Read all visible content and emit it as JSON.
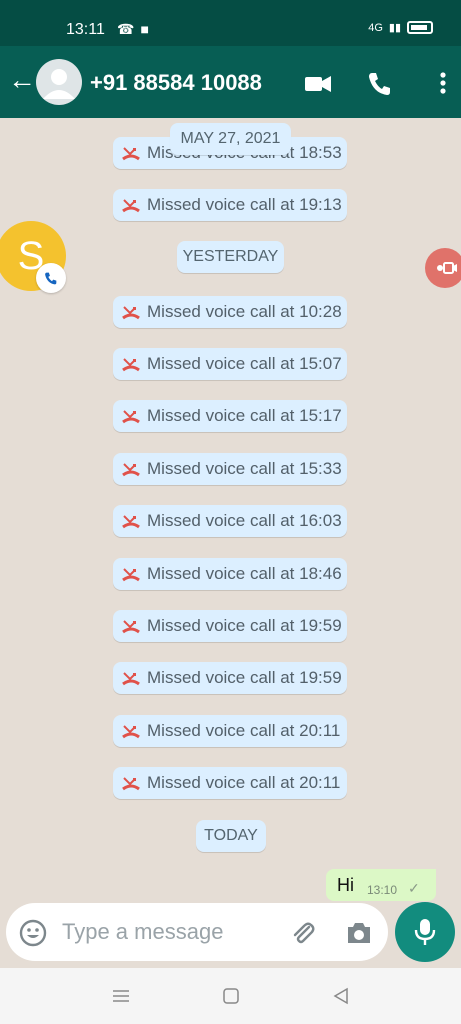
{
  "status_bar": {
    "time": "13:11",
    "network": "4G"
  },
  "header": {
    "contact": "+91 88584 10088",
    "icons": [
      "back-arrow-icon",
      "avatar",
      "video-call-icon",
      "voice-call-icon",
      "more-icon"
    ]
  },
  "messages": [
    {
      "type": "missed_call",
      "text": "Missed voice call at 18:53"
    },
    {
      "type": "missed_call",
      "text": "Missed voice call at 19:13"
    },
    {
      "type": "missed_call",
      "text": "Missed voice call at 10:28"
    },
    {
      "type": "missed_call",
      "text": "Missed voice call at 15:07"
    },
    {
      "type": "missed_call",
      "text": "Missed voice call at 15:17"
    },
    {
      "type": "missed_call",
      "text": "Missed voice call at 15:33"
    },
    {
      "type": "missed_call",
      "text": "Missed voice call at 16:03"
    },
    {
      "type": "missed_call",
      "text": "Missed voice call at 18:46"
    },
    {
      "type": "missed_call",
      "text": "Missed voice call at 19:59"
    },
    {
      "type": "missed_call",
      "text": "Missed voice call at 19:59"
    },
    {
      "type": "missed_call",
      "text": "Missed voice call at 20:11"
    },
    {
      "type": "missed_call",
      "text": "Missed voice call at 20:11"
    }
  ],
  "date_separators": {
    "first": "MAY 27, 2021",
    "second": "YESTERDAY",
    "third": "TODAY"
  },
  "floating": {
    "avatar_letter": "S"
  },
  "outgoing": {
    "text": "Hi",
    "time": "13:10",
    "status": "✓"
  },
  "composer": {
    "placeholder": "Type a message"
  },
  "colors": {
    "status_bar": "#054d44",
    "header": "#075e54",
    "chat_bg": "#e5ddd5",
    "system_chip": "#dcefff",
    "missed_red": "#e0524a",
    "outgoing_bubble": "#dcf8c6",
    "mic_button": "#128c7e"
  }
}
